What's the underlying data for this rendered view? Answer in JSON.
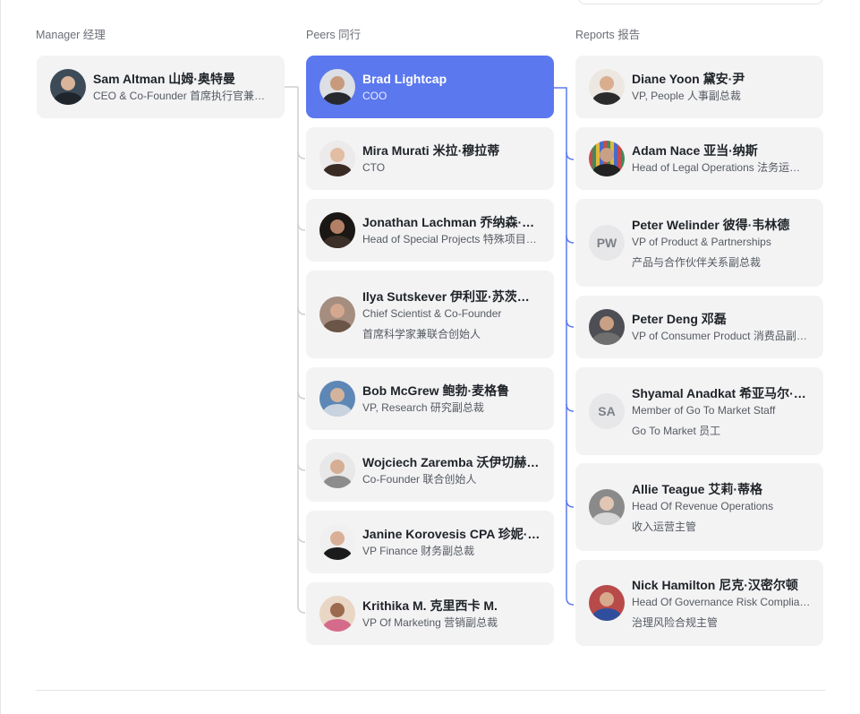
{
  "columns": {
    "manager_label": "Manager 经理",
    "peers_label": "Peers 同行",
    "reports_label": "Reports 报告"
  },
  "manager": {
    "name": "Sam Altman 山姆·奥特曼",
    "title": "CEO & Co-Founder 首席执行官兼联合创始人"
  },
  "peers": [
    {
      "name": "Brad Lightcap",
      "title": "COO",
      "selected": true
    },
    {
      "name": "Mira Murati 米拉·穆拉蒂",
      "title": "CTO"
    },
    {
      "name": "Jonathan Lachman 乔纳森·拉赫曼",
      "title": "Head of Special Projects 特殊项目负责人"
    },
    {
      "name": "Ilya Sutskever 伊利亚·苏茨凯弗",
      "title": "Chief Scientist & Co-Founder",
      "title2": "首席科学家兼联合创始人"
    },
    {
      "name": "Bob McGrew 鲍勃·麦格鲁",
      "title": "VP, Research 研究副总裁"
    },
    {
      "name": "Wojciech Zaremba 沃伊切赫·扎伦巴",
      "title": "Co-Founder 联合创始人"
    },
    {
      "name": "Janine Korovesis CPA 珍妮·科罗维西斯",
      "title": "VP Finance 财务副总裁"
    },
    {
      "name": "Krithika M. 克里西卡 M.",
      "title": "VP Of Marketing 营销副总裁"
    }
  ],
  "reports": [
    {
      "name": "Diane Yoon 黛安·尹",
      "title": "VP, People 人事副总裁"
    },
    {
      "name": "Adam Nace 亚当·纳斯",
      "title": "Head of Legal Operations 法务运营负责人"
    },
    {
      "name": "Peter Welinder 彼得·韦林德",
      "title": "VP of Product & Partnerships",
      "title2": "产品与合作伙伴关系副总裁",
      "initials": "PW"
    },
    {
      "name": "Peter Deng 邓磊",
      "title": "VP of Consumer Product 消费品副总裁"
    },
    {
      "name": "Shyamal Anadkat 希亚马尔·阿纳德卡特",
      "title": "Member of Go To Market Staff",
      "title2": "Go To Market 员工",
      "initials": "SA"
    },
    {
      "name": "Allie Teague 艾莉·蒂格",
      "title": "Head Of Revenue Operations",
      "title2": "收入运营主管"
    },
    {
      "name": "Nick Hamilton 尼克·汉密尔顿",
      "title": "Head Of Governance Risk Compliance",
      "title2": "治理风险合规主管"
    }
  ],
  "colors": {
    "selected_card": "#5b78ee",
    "card": "#f3f3f4",
    "peer_connector": "#cfcfd3",
    "report_connector": "#5b78ee"
  }
}
